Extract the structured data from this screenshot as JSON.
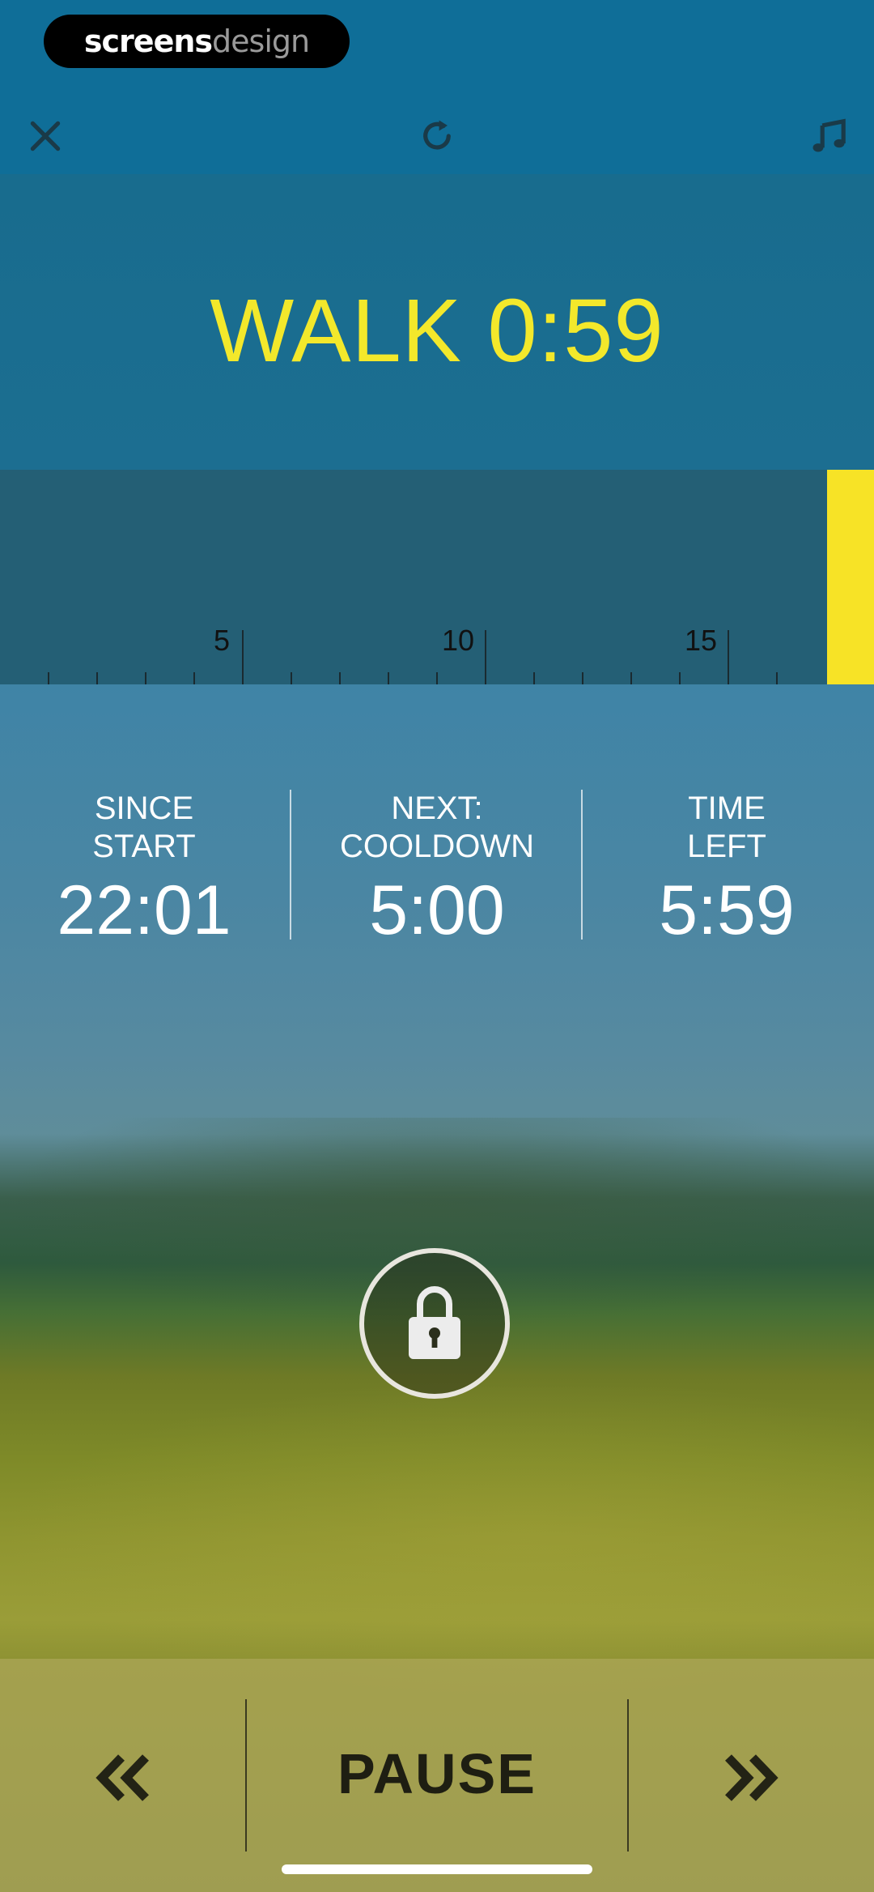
{
  "watermark": {
    "part1": "screens",
    "part2": "design"
  },
  "top_bar": {
    "close_icon": "close-icon",
    "restart_icon": "restart-icon",
    "music_icon": "music-icon"
  },
  "interval": {
    "label": "WALK 0:59"
  },
  "timeline": {
    "tick_labels": [
      "5",
      "10",
      "15"
    ],
    "progress_color": "#f7e326"
  },
  "stats": [
    {
      "label": "SINCE\nSTART",
      "value": "22:01"
    },
    {
      "label": "NEXT:\nCOOLDOWN",
      "value": "5:00"
    },
    {
      "label": "TIME\nLEFT",
      "value": "5:59"
    }
  ],
  "lock": {
    "icon": "lock-icon"
  },
  "controls": {
    "back_icon": "rewind-icon",
    "pause_label": "PAUSE",
    "forward_icon": "fast-forward-icon"
  },
  "colors": {
    "accent": "#f3e82b",
    "header_bg": "#0f6e98"
  }
}
